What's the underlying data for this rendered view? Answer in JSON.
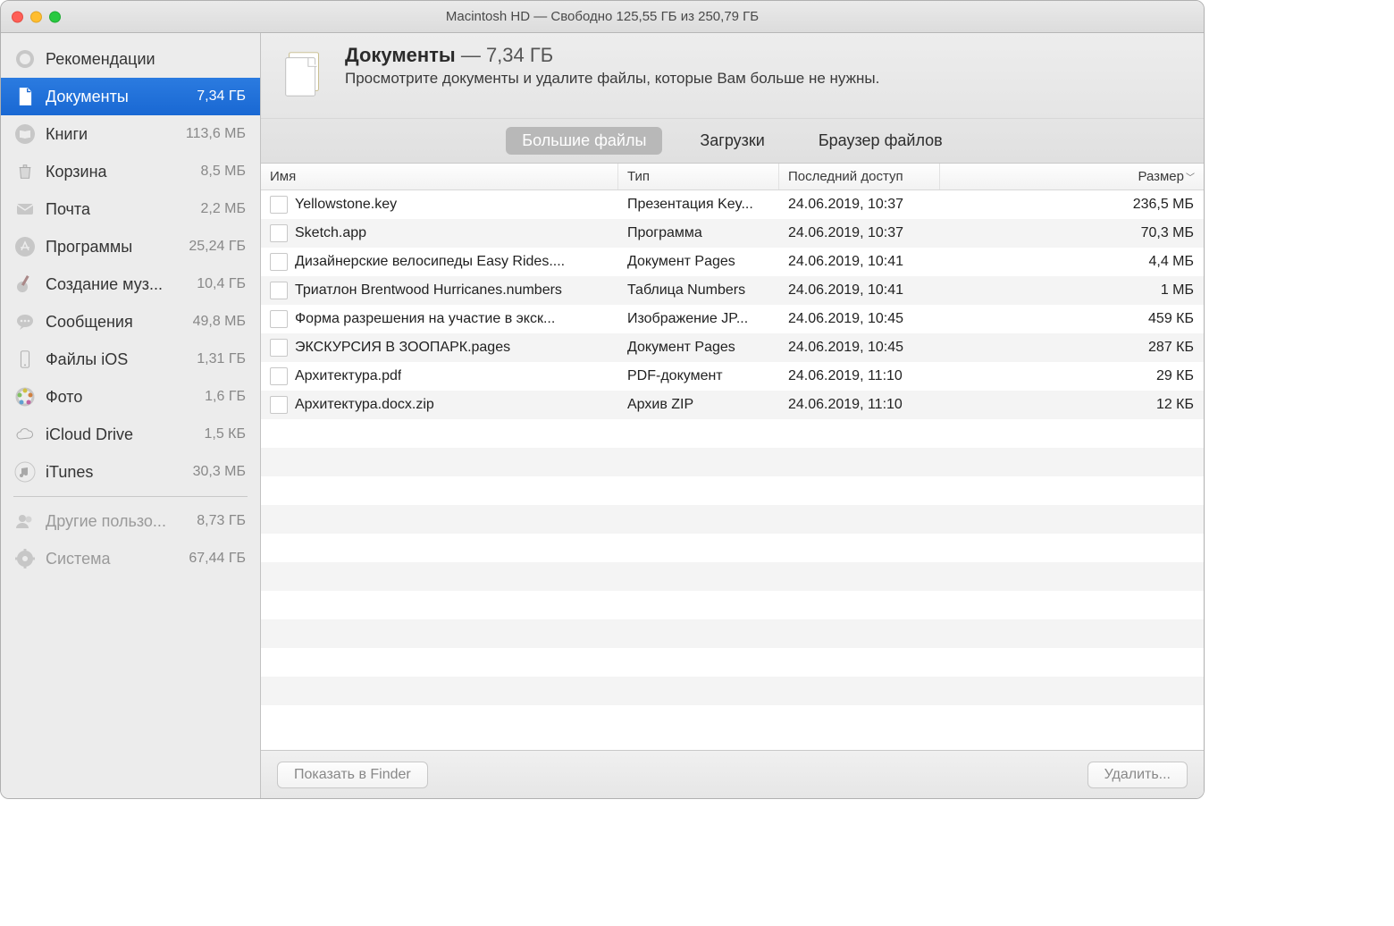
{
  "titlebar": {
    "title": "Macintosh HD — Свободно 125,55 ГБ из 250,79 ГБ"
  },
  "sidebar": {
    "items": [
      {
        "label": "Рекомендации",
        "size": ""
      },
      {
        "label": "Документы",
        "size": "7,34 ГБ"
      },
      {
        "label": "Книги",
        "size": "113,6 МБ"
      },
      {
        "label": "Корзина",
        "size": "8,5 МБ"
      },
      {
        "label": "Почта",
        "size": "2,2 МБ"
      },
      {
        "label": "Программы",
        "size": "25,24 ГБ"
      },
      {
        "label": "Создание муз...",
        "size": "10,4 ГБ"
      },
      {
        "label": "Сообщения",
        "size": "49,8 МБ"
      },
      {
        "label": "Файлы iOS",
        "size": "1,31 ГБ"
      },
      {
        "label": "Фото",
        "size": "1,6 ГБ"
      },
      {
        "label": "iCloud Drive",
        "size": "1,5 КБ"
      },
      {
        "label": "iTunes",
        "size": "30,3 МБ"
      }
    ],
    "extra": [
      {
        "label": "Другие пользо...",
        "size": "8,73 ГБ"
      },
      {
        "label": "Система",
        "size": "67,44 ГБ"
      }
    ]
  },
  "header": {
    "title_main": "Документы",
    "title_sep": " — ",
    "title_size": "7,34 ГБ",
    "subtitle": "Просмотрите документы и удалите файлы, которые Вам больше не нужны."
  },
  "tabs": [
    {
      "label": "Большие файлы"
    },
    {
      "label": "Загрузки"
    },
    {
      "label": "Браузер файлов"
    }
  ],
  "table": {
    "headers": {
      "name": "Имя",
      "type": "Тип",
      "access": "Последний доступ",
      "size": "Размер"
    },
    "rows": [
      {
        "name": "Yellowstone.key",
        "type": "Презентация Key...",
        "access": "24.06.2019, 10:37",
        "size": "236,5 МБ"
      },
      {
        "name": "Sketch.app",
        "type": "Программа",
        "access": "24.06.2019, 10:37",
        "size": "70,3 МБ"
      },
      {
        "name": "Дизайнерские велосипеды Easy Rides....",
        "type": "Документ Pages",
        "access": "24.06.2019, 10:41",
        "size": "4,4 МБ"
      },
      {
        "name": "Триатлон Brentwood Hurricanes.numbers",
        "type": "Таблица Numbers",
        "access": "24.06.2019, 10:41",
        "size": "1 МБ"
      },
      {
        "name": "Форма разрешения на участие в экск...",
        "type": "Изображение JP...",
        "access": "24.06.2019, 10:45",
        "size": "459 КБ"
      },
      {
        "name": "ЭКСКУРСИЯ В ЗООПАРК.pages",
        "type": "Документ Pages",
        "access": "24.06.2019, 10:45",
        "size": "287  КБ"
      },
      {
        "name": "Архитектура.pdf",
        "type": "PDF-документ",
        "access": "24.06.2019, 11:10",
        "size": "29  КБ"
      },
      {
        "name": "Архитектура.docx.zip",
        "type": "Архив ZIP",
        "access": "24.06.2019, 11:10",
        "size": "12  КБ"
      }
    ]
  },
  "footer": {
    "show_in_finder": "Показать в Finder",
    "delete": "Удалить..."
  }
}
